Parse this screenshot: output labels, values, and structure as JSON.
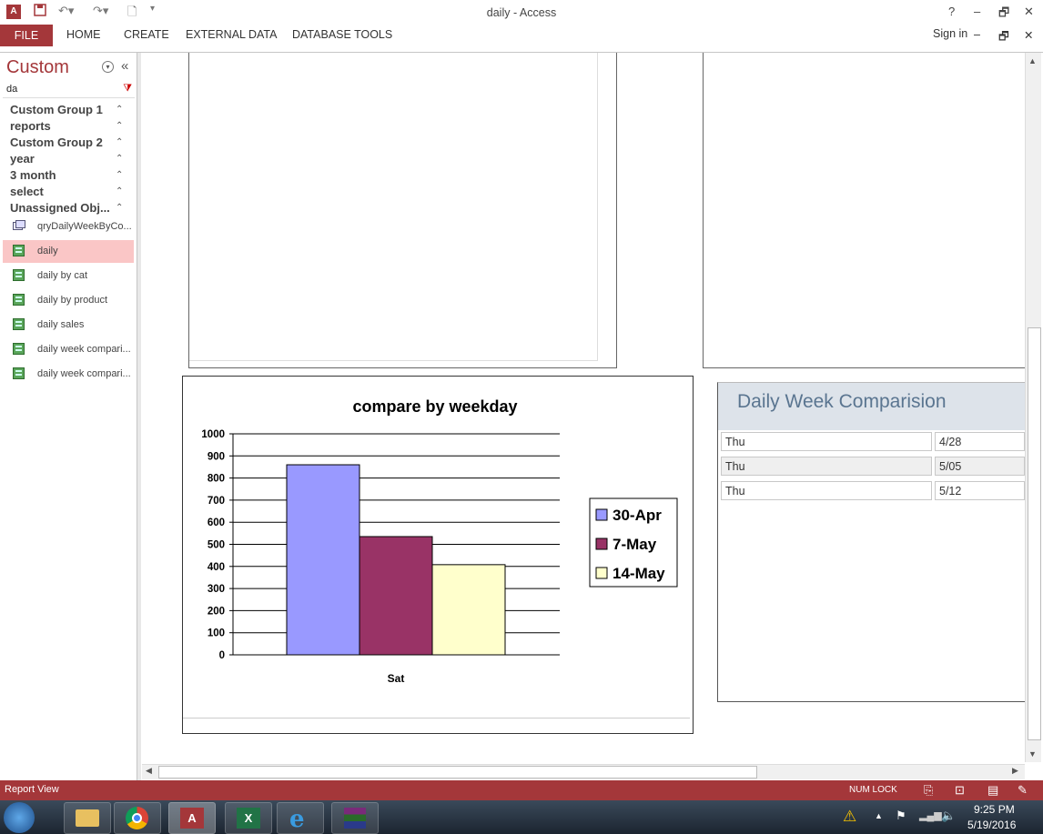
{
  "window": {
    "title": "daily - Access",
    "help": "?",
    "minimize": "–",
    "restore": "🗗",
    "close": "✕"
  },
  "ribbon": {
    "tabs": [
      "FILE",
      "HOME",
      "CREATE",
      "EXTERNAL DATA",
      "DATABASE TOOLS"
    ],
    "sign_in": "Sign in"
  },
  "nav": {
    "title": "Custom",
    "search_value": "da",
    "groups": [
      "Custom Group 1",
      "reports",
      "Custom Group 2",
      "year",
      "3 month",
      "select",
      "Unassigned Obj..."
    ],
    "objects": [
      {
        "label": "qryDailyWeekByCo...",
        "icon": "query-icon",
        "selected": false
      },
      {
        "label": "daily",
        "icon": "report-icon",
        "selected": true
      },
      {
        "label": "daily by cat",
        "icon": "report-icon",
        "selected": false
      },
      {
        "label": "daily by product",
        "icon": "report-icon",
        "selected": false
      },
      {
        "label": "daily sales",
        "icon": "report-icon",
        "selected": false
      },
      {
        "label": "daily week compari...",
        "icon": "report-icon",
        "selected": false
      },
      {
        "label": "daily week compari...",
        "icon": "report-icon",
        "selected": false
      }
    ]
  },
  "chart_data": {
    "type": "bar",
    "title": "compare by weekday",
    "categories": [
      "Sat"
    ],
    "series": [
      {
        "name": "30-Apr",
        "values": [
          860
        ],
        "color": "#9999ff"
      },
      {
        "name": "7-May",
        "values": [
          535
        ],
        "color": "#993366"
      },
      {
        "name": "14-May",
        "values": [
          408
        ],
        "color": "#ffffcc"
      }
    ],
    "ylim": [
      0,
      1000
    ],
    "yticks": [
      "0",
      "100",
      "200",
      "300",
      "400",
      "500",
      "600",
      "700",
      "800",
      "900",
      "1000"
    ],
    "grid": true,
    "legend": "right"
  },
  "subreport": {
    "title": "Daily Week Comparision",
    "rows": [
      {
        "day": "Thu",
        "date": "4/28"
      },
      {
        "day": "Thu",
        "date": "5/05"
      },
      {
        "day": "Thu",
        "date": "5/12"
      }
    ]
  },
  "status": {
    "left": "Report View",
    "num_lock": "NUM LOCK"
  },
  "taskbar": {
    "time": "9:25 PM",
    "date": "5/19/2016"
  },
  "colors": {
    "accent": "#a4373a",
    "selected": "#fac6c6"
  }
}
